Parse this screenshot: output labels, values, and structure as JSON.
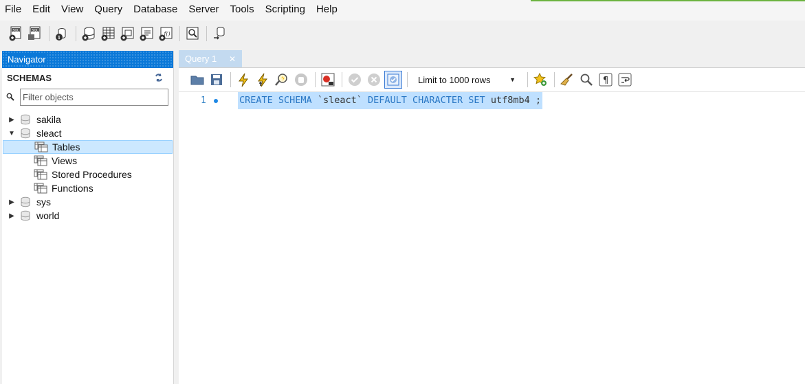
{
  "menu": [
    "File",
    "Edit",
    "View",
    "Query",
    "Database",
    "Server",
    "Tools",
    "Scripting",
    "Help"
  ],
  "navigator": {
    "title": "Navigator",
    "schemas_label": "SCHEMAS",
    "filter_placeholder": "Filter objects",
    "schemas": [
      {
        "name": "sakila",
        "expanded": false
      },
      {
        "name": "sleact",
        "expanded": true,
        "children": [
          "Tables",
          "Views",
          "Stored Procedures",
          "Functions"
        ],
        "selected": "Tables"
      },
      {
        "name": "sys",
        "expanded": false
      },
      {
        "name": "world",
        "expanded": false
      }
    ]
  },
  "editor": {
    "tab_label": "Query 1",
    "limit_label": "Limit to 1000 rows",
    "line_number": "1",
    "sql": {
      "kw1": "CREATE SCHEMA",
      "name": "`sleact`",
      "kw2": "DEFAULT CHARACTER SET",
      "charset": "utf8mb4 ;"
    }
  },
  "colors": {
    "accent": "#0a78d8",
    "selection": "#cce8ff",
    "keyword": "#2b78c5",
    "success": "#6cb33f"
  }
}
